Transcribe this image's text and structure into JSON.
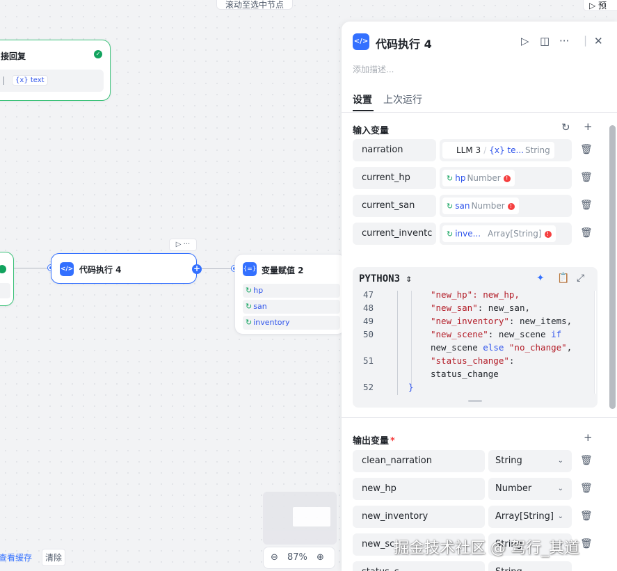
{
  "canvas": {
    "top_hint": "滚动至选中节点",
    "top_button": "▷ 预",
    "reply_node": {
      "title": "接回复",
      "chip": "{x} text"
    },
    "code_node": {
      "title": "代码执行 4",
      "icon": "</>"
    },
    "mini_toolbar": "▷  ···",
    "assign_node": {
      "title": "变量赋值 2",
      "icon": "{=}",
      "rows": [
        "hp",
        "san",
        "inventory"
      ]
    },
    "zoom": {
      "out": "⊖",
      "level": "87%",
      "in": "⊕"
    },
    "cache": {
      "view": "查看缓存",
      "clear": "清除"
    }
  },
  "panel": {
    "icon": "</>",
    "title": "代码执行 4",
    "description_placeholder": "添加描述...",
    "tabs": [
      "设置",
      "上次运行"
    ],
    "inputs_title": "输入变量",
    "inputs": [
      {
        "name": "narration",
        "node": "LLM 3",
        "var": "{x} te...",
        "type": "String",
        "error": false
      },
      {
        "name": "current_hp",
        "node": "",
        "var": "hp",
        "type": "Number",
        "error": true
      },
      {
        "name": "current_san",
        "node": "",
        "var": "san",
        "type": "Number",
        "error": true
      },
      {
        "name": "current_inventc",
        "node": "",
        "var": "inve...",
        "type": "Array[String]",
        "error": true
      }
    ],
    "code": {
      "language": "PYTHON3",
      "lines": [
        {
          "n": "47",
          "parts": [
            {
              "t": "\"new_hp\": new_hp,",
              "c": "mix"
            }
          ]
        },
        {
          "n": "48",
          "parts": [
            {
              "t": "\"new_san\"",
              "c": "str"
            },
            {
              "t": ": new_san,",
              "c": ""
            }
          ]
        },
        {
          "n": "49",
          "parts": [
            {
              "t": "\"new_inventory\"",
              "c": "str"
            },
            {
              "t": ": new_items,",
              "c": ""
            }
          ]
        },
        {
          "n": "50",
          "parts": [
            {
              "t": "\"new_scene\"",
              "c": "str"
            },
            {
              "t": ": new_scene ",
              "c": ""
            },
            {
              "t": "if",
              "c": "kw"
            }
          ]
        },
        {
          "n": "",
          "parts": [
            {
              "t": "new_scene ",
              "c": ""
            },
            {
              "t": "else",
              "c": "kw"
            },
            {
              "t": " ",
              "c": ""
            },
            {
              "t": "\"no_change\"",
              "c": "str"
            },
            {
              "t": ",",
              "c": ""
            }
          ]
        },
        {
          "n": "51",
          "parts": [
            {
              "t": "\"status_change\"",
              "c": "str"
            },
            {
              "t": ":",
              "c": ""
            }
          ]
        },
        {
          "n": "",
          "parts": [
            {
              "t": "status_change",
              "c": ""
            }
          ]
        },
        {
          "n": "52",
          "parts": [
            {
              "t": "}",
              "c": "kw"
            }
          ]
        }
      ]
    },
    "outputs_title": "输出变量",
    "outputs": [
      {
        "name": "clean_narration",
        "type": "String"
      },
      {
        "name": "new_hp",
        "type": "Number"
      },
      {
        "name": "new_inventory",
        "type": "Array[String]"
      },
      {
        "name": "new_sc",
        "type": "String"
      },
      {
        "name": "status_c",
        "type": "String"
      }
    ]
  },
  "watermark": "掘金技术社区 @ 驾行_其道",
  "colors": {
    "accent": "#3370ff",
    "success": "#12a35e",
    "error": "#f53f3f"
  }
}
